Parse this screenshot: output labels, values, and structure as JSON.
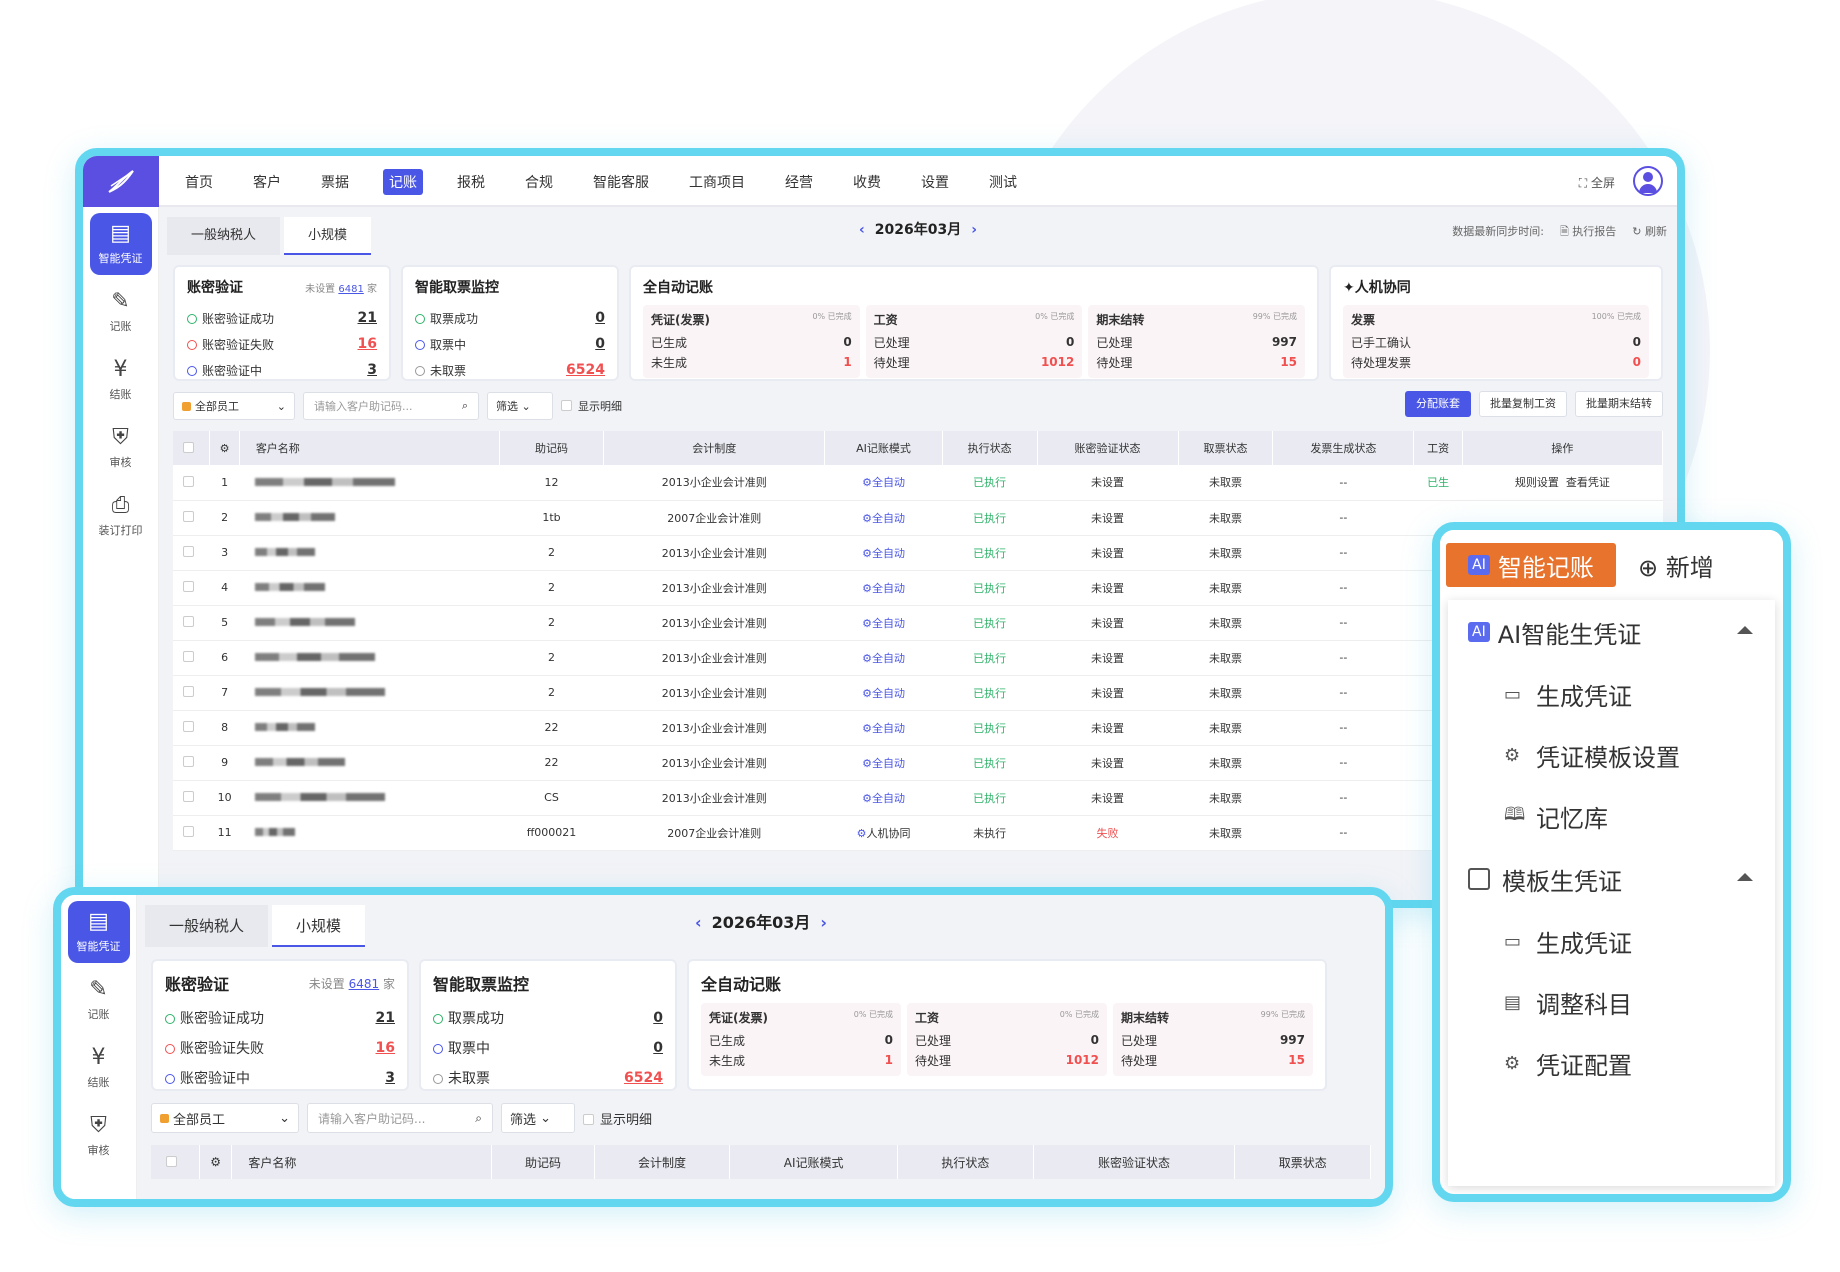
{
  "nav": {
    "items": [
      "首页",
      "客户",
      "票据",
      "记账",
      "报税",
      "合规",
      "智能客服",
      "工商项目",
      "经营",
      "收费",
      "设置",
      "测试"
    ],
    "active": "记账",
    "fullscreen": "全屏"
  },
  "sidebar": {
    "items": [
      {
        "label": "智能凭证",
        "icon": "voucher-icon"
      },
      {
        "label": "记账",
        "icon": "edit-icon"
      },
      {
        "label": "结账",
        "icon": "yen-icon"
      },
      {
        "label": "审核",
        "icon": "shield-icon"
      },
      {
        "label": "装订打印",
        "icon": "printer-icon"
      }
    ]
  },
  "tabs": [
    "一般纳税人",
    "小规模"
  ],
  "month": "2026年03月",
  "sync": {
    "label": "数据最新同步时间:",
    "report": "执行报告",
    "refresh": "刷新"
  },
  "account_verify": {
    "title": "账密验证",
    "unset_prefix": "未设置",
    "unset_count": "6481",
    "unset_suffix": "家",
    "rows": [
      {
        "label": "账密验证成功",
        "value": "21"
      },
      {
        "label": "账密验证失败",
        "value": "16"
      },
      {
        "label": "账密验证中",
        "value": "3"
      }
    ]
  },
  "invoice_monitor": {
    "title": "智能取票监控",
    "rows": [
      {
        "label": "取票成功",
        "value": "0"
      },
      {
        "label": "取票中",
        "value": "0"
      },
      {
        "label": "未取票",
        "value": "6524"
      }
    ]
  },
  "auto_booking": {
    "title": "全自动记账",
    "subs": [
      {
        "title": "凭证(发票)",
        "pct": "0% 已完成",
        "r1": "已生成",
        "v1": "0",
        "r2": "未生成",
        "v2": "1"
      },
      {
        "title": "工资",
        "pct": "0% 已完成",
        "r1": "已处理",
        "v1": "0",
        "r2": "待处理",
        "v2": "1012"
      },
      {
        "title": "期末结转",
        "pct": "99% 已完成",
        "r1": "已处理",
        "v1": "997",
        "r2": "待处理",
        "v2": "15"
      }
    ]
  },
  "collab": {
    "title": "人机协同",
    "sub": {
      "title": "发票",
      "pct": "100% 已完成",
      "r1": "已手工确认",
      "v1": "0",
      "r2": "待处理发票",
      "v2": "0"
    }
  },
  "filters": {
    "staff": "全部员工",
    "search_placeholder": "请输入客户助记码...",
    "filter": "筛选",
    "show_detail": "显示明细"
  },
  "actions": {
    "assign": "分配账套",
    "batch_salary": "批量复制工资",
    "batch_close": "批量期末结转"
  },
  "table": {
    "headers": [
      "客户名称",
      "助记码",
      "会计制度",
      "AI记账模式",
      "执行状态",
      "账密验证状态",
      "取票状态",
      "发票生成状态",
      "工资",
      "操作"
    ],
    "rows": [
      {
        "no": "1",
        "code": "12",
        "system": "2013小企业会计准则",
        "mode": "全自动",
        "exec": "已执行",
        "verify": "未设置",
        "ticket": "未取票",
        "inv": "--",
        "salary": "已生",
        "ops": [
          "规则设置",
          "查看凭证"
        ]
      },
      {
        "no": "2",
        "code": "1tb",
        "system": "2007企业会计准则",
        "mode": "全自动",
        "exec": "已执行",
        "verify": "未设置",
        "ticket": "未取票",
        "inv": "--"
      },
      {
        "no": "3",
        "code": "2",
        "system": "2013小企业会计准则",
        "mode": "全自动",
        "exec": "已执行",
        "verify": "未设置",
        "ticket": "未取票",
        "inv": "--"
      },
      {
        "no": "4",
        "code": "2",
        "system": "2013小企业会计准则",
        "mode": "全自动",
        "exec": "已执行",
        "verify": "未设置",
        "ticket": "未取票",
        "inv": "--"
      },
      {
        "no": "5",
        "code": "2",
        "system": "2013小企业会计准则",
        "mode": "全自动",
        "exec": "已执行",
        "verify": "未设置",
        "ticket": "未取票",
        "inv": "--"
      },
      {
        "no": "6",
        "code": "2",
        "system": "2013小企业会计准则",
        "mode": "全自动",
        "exec": "已执行",
        "verify": "未设置",
        "ticket": "未取票",
        "inv": "--"
      },
      {
        "no": "7",
        "code": "2",
        "system": "2013小企业会计准则",
        "mode": "全自动",
        "exec": "已执行",
        "verify": "未设置",
        "ticket": "未取票",
        "inv": "--"
      },
      {
        "no": "8",
        "code": "22",
        "system": "2013小企业会计准则",
        "mode": "全自动",
        "exec": "已执行",
        "verify": "未设置",
        "ticket": "未取票",
        "inv": "--"
      },
      {
        "no": "9",
        "code": "22",
        "system": "2013小企业会计准则",
        "mode": "全自动",
        "exec": "已执行",
        "verify": "未设置",
        "ticket": "未取票",
        "inv": "--"
      },
      {
        "no": "10",
        "code": "CS",
        "system": "2013小企业会计准则",
        "mode": "全自动",
        "exec": "已执行",
        "verify": "未设置",
        "ticket": "未取票",
        "inv": "--"
      },
      {
        "no": "11",
        "code": "ff000021",
        "system": "2007企业会计准则",
        "mode": "人机协同",
        "exec": "未执行",
        "verify": "失败",
        "ticket": "未取票",
        "inv": "--"
      }
    ]
  },
  "popup": {
    "ai_label": "AI",
    "main": "智能记账",
    "add": "新增",
    "groups": [
      {
        "badge": "AI",
        "title": "AI智能生凭证",
        "items": [
          "生成凭证",
          "凭证模板设置",
          "记忆库"
        ]
      },
      {
        "badge": "",
        "title": "模板生凭证",
        "items": [
          "生成凭证",
          "调整科目",
          "凭证配置"
        ]
      }
    ]
  },
  "colors": {
    "accent": "#4a56e6",
    "frame": "#62d7ef",
    "danger": "#f05050",
    "success": "#2fb36a",
    "ai_button": "#e8732d"
  }
}
